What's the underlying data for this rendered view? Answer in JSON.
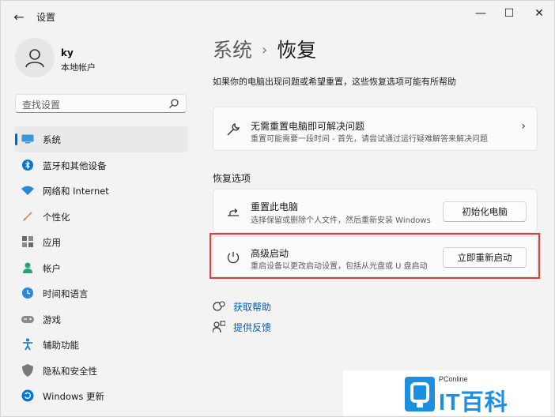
{
  "window": {
    "back_glyph": "←",
    "title": "设置",
    "min_glyph": "—",
    "max_glyph": "☐",
    "close_glyph": "✕"
  },
  "profile": {
    "name": "ky",
    "account_type": "本地帐户"
  },
  "search": {
    "placeholder": "查找设置"
  },
  "sidebar": {
    "items": [
      {
        "label": "系统",
        "icon": "monitor-icon",
        "color": "#0078d4",
        "active": true
      },
      {
        "label": "蓝牙和其他设备",
        "icon": "bluetooth-icon",
        "color": "#0078d4"
      },
      {
        "label": "网络和 Internet",
        "icon": "wifi-icon",
        "color": "#2b88d8"
      },
      {
        "label": "个性化",
        "icon": "brush-icon",
        "color": "#d67c2e"
      },
      {
        "label": "应用",
        "icon": "apps-icon",
        "color": "#6b6b6b"
      },
      {
        "label": "帐户",
        "icon": "person-icon",
        "color": "#21a67a"
      },
      {
        "label": "时间和语言",
        "icon": "clock-globe-icon",
        "color": "#2b88d8"
      },
      {
        "label": "游戏",
        "icon": "gamepad-icon",
        "color": "#8a8a8a"
      },
      {
        "label": "辅助功能",
        "icon": "accessibility-icon",
        "color": "#1f7fd8"
      },
      {
        "label": "隐私和安全性",
        "icon": "shield-icon",
        "color": "#7a7a7a"
      },
      {
        "label": "Windows 更新",
        "icon": "update-icon",
        "color": "#0078d4"
      }
    ]
  },
  "main": {
    "breadcrumb_parent": "系统",
    "breadcrumb_sep": "›",
    "breadcrumb_current": "恢复",
    "description": "如果你的电脑出现问题或希望重置，这些恢复选项可能有所帮助",
    "troubleshoot_card": {
      "title": "无需重置电脑即可解决问题",
      "subtitle": "重置可能需要一段时间 - 首先，请尝试通过运行疑难解答来解决问题",
      "chevron": "›"
    },
    "section_title": "恢复选项",
    "reset_card": {
      "title": "重置此电脑",
      "subtitle": "选择保留或删除个人文件，然后重新安装 Windows",
      "button": "初始化电脑"
    },
    "advanced_card": {
      "title": "高级启动",
      "subtitle": "重启设备以更改启动设置，包括从光盘或 U 盘启动",
      "button": "立即重新启动"
    },
    "links": [
      {
        "label": "获取帮助",
        "icon": "help-icon"
      },
      {
        "label": "提供反馈",
        "icon": "feedback-icon"
      }
    ]
  },
  "watermark": {
    "small": "PConline",
    "big": "IT百科"
  },
  "colors": {
    "accent": "#0067c0",
    "highlight": "#e53935",
    "link": "#0c5aa6"
  }
}
